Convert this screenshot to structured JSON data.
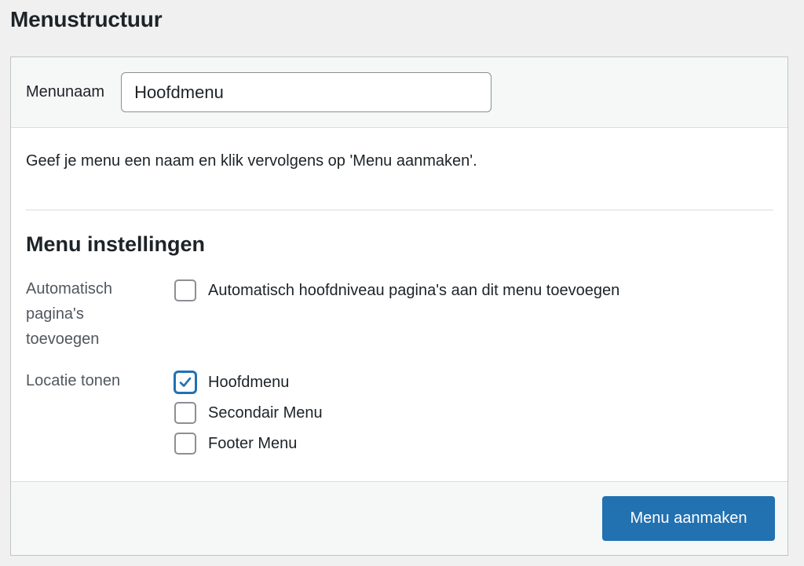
{
  "page": {
    "title": "Menustructuur"
  },
  "header": {
    "name_label": "Menunaam",
    "name_value": "Hoofdmenu"
  },
  "body": {
    "instructions": "Geef je menu een naam en klik vervolgens op 'Menu aanmaken'.",
    "settings_title": "Menu instellingen",
    "auto_add": {
      "label": "Automatisch pagina's toevoegen",
      "option_label": "Automatisch hoofdniveau pagina's aan dit menu toevoegen",
      "checked": false
    },
    "locations": {
      "label": "Locatie tonen",
      "options": [
        {
          "label": "Hoofdmenu",
          "checked": true
        },
        {
          "label": "Secondair Menu",
          "checked": false
        },
        {
          "label": "Footer Menu",
          "checked": false
        }
      ]
    }
  },
  "footer": {
    "create_label": "Menu aanmaken"
  },
  "colors": {
    "accent": "#2271b1",
    "background": "#f0f0f1",
    "panel": "#ffffff",
    "header": "#f6f7f7"
  }
}
